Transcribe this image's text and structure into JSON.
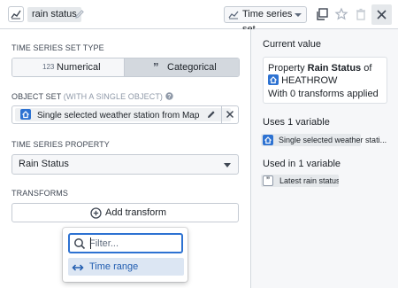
{
  "header": {
    "title_chip": "rain status",
    "type_select": "Time series set",
    "icons": [
      "time-series-icon",
      "pencil-icon",
      "chart-icon",
      "duplicate-icon",
      "star-icon",
      "trash-icon",
      "close-icon"
    ]
  },
  "left": {
    "set_type": {
      "label": "TIME SERIES SET TYPE",
      "numerical_badge": "123",
      "numerical": "Numerical",
      "categorical_badge": "”",
      "categorical": "Categorical",
      "selected": "Categorical"
    },
    "object_set": {
      "label": "OBJECT SET",
      "label_hint": "(WITH A SINGLE OBJECT)",
      "value": "Single selected weather station from Map"
    },
    "property": {
      "label": "TIME SERIES PROPERTY",
      "value": "Rain Status"
    },
    "transforms": {
      "label": "TRANSFORMS",
      "add_label": "Add transform"
    },
    "popover": {
      "filter_placeholder": "Filter...",
      "items": [
        {
          "label": "Time range",
          "icon": "arrows-horizontal-icon"
        }
      ]
    }
  },
  "right": {
    "current_value": {
      "heading": "Current value",
      "prefix": "Property",
      "property": "Rain Status",
      "suffix": "of",
      "object": "HEATHROW",
      "transforms_text": "With 0 transforms applied"
    },
    "uses": {
      "heading": "Uses 1 variable",
      "item": "Single selected weather stati..."
    },
    "used_in": {
      "heading": "Used in 1 variable",
      "item": "Latest rain status"
    }
  },
  "colors": {
    "accent": "#2d72d2",
    "panel_bg": "#f6f7f9",
    "border": "#c5cbd3",
    "selected_segment": "#d3d8de",
    "menu_item_bg": "#dce6f3"
  }
}
